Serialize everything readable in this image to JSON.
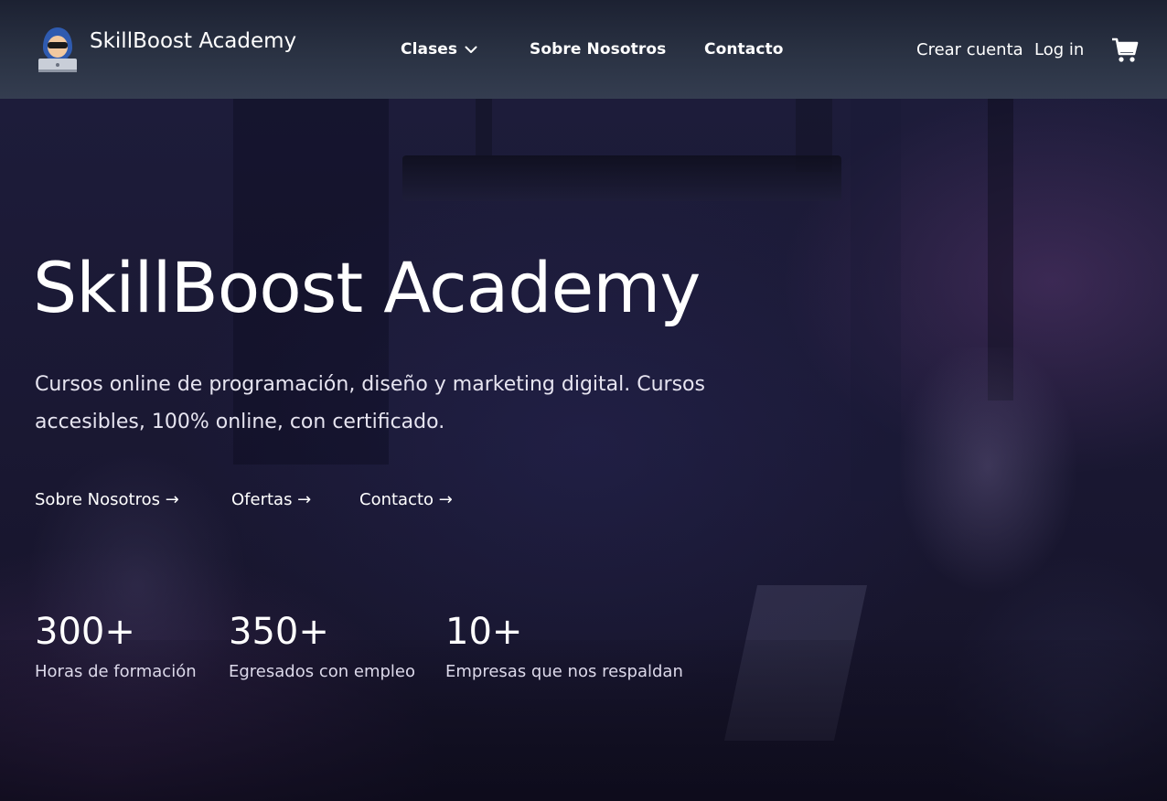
{
  "brand": {
    "name": "SkillBoost Academy",
    "logo_icon": "hacker-avatar-icon"
  },
  "nav": {
    "items": [
      {
        "label": "Clases",
        "has_dropdown": true
      },
      {
        "label": "Sobre Nosotros"
      },
      {
        "label": "Contacto"
      }
    ],
    "create_account": "Crear cuenta",
    "login": "Log in",
    "cart_icon": "shopping-cart-icon"
  },
  "hero": {
    "title": "SkillBoost Academy",
    "subtitle": "Cursos online de programación, diseño y marketing digital. Cursos accesibles, 100% online, con certificado.",
    "links": [
      {
        "label": "Sobre Nosotros →"
      },
      {
        "label": "Ofertas →"
      },
      {
        "label": "Contacto →"
      }
    ],
    "stats": [
      {
        "value": "300+",
        "label": "Horas de formación"
      },
      {
        "value": "350+",
        "label": "Egresados con empleo"
      },
      {
        "value": "10+",
        "label": "Empresas que nos respaldan"
      }
    ]
  },
  "colors": {
    "navbar": "#2a3243",
    "hero_overlay": "#1a1833",
    "text": "#ffffff"
  }
}
